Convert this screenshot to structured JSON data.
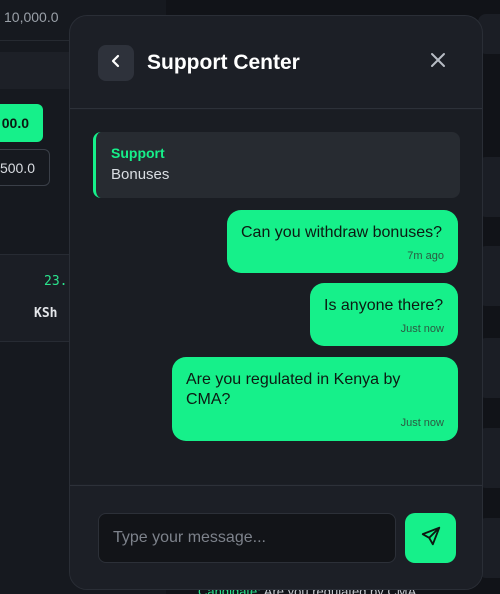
{
  "background": {
    "top_value": "10,000.0",
    "amount_button": "00.0",
    "amount_input": "500.0",
    "odds_value": "23.",
    "currency": "KSh",
    "bottom_text_prefix": "Candidate:",
    "bottom_text": "Are you regulated by CMA"
  },
  "chat": {
    "title": "Support Center",
    "system_message": {
      "sender": "Support",
      "text": "Bonuses"
    },
    "messages": [
      {
        "text": "Can you withdraw bonuses?",
        "time": "7m ago"
      },
      {
        "text": "Is anyone there?",
        "time": "Just now"
      },
      {
        "text": "Are you regulated in Kenya by CMA?",
        "time": "Just now"
      }
    ],
    "input": {
      "placeholder": "Type your message...",
      "value": ""
    }
  },
  "colors": {
    "accent": "#16f08a",
    "modal_bg": "#1c1f26",
    "page_bg": "#111318"
  },
  "icons": {
    "back": "chevron-left-icon",
    "close": "close-icon",
    "send": "send-icon"
  }
}
